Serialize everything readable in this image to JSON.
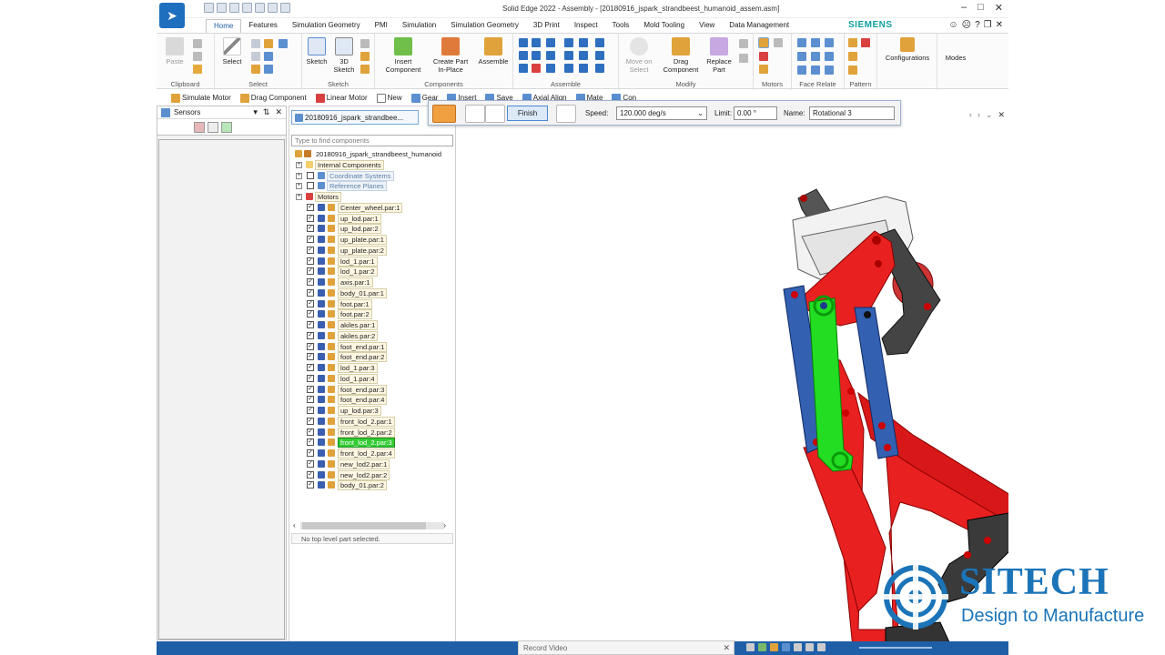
{
  "window": {
    "title": "Solid Edge 2022 - Assembly - [20180916_jspark_strandbeest_humanoid_assem.asm]"
  },
  "tabs": [
    "Home",
    "Features",
    "Simulation Geometry",
    "PMI",
    "Simulation",
    "Simulation Geometry",
    "3D Print",
    "Inspect",
    "Tools",
    "Mold Tooling",
    "View",
    "Data Management"
  ],
  "brand": "SIEMENS",
  "ribbon": {
    "paste": "Paste",
    "clipboard": "Clipboard",
    "select": "Select",
    "select_group": "Select",
    "sketch": "Sketch",
    "sketch3d_line1": "3D",
    "sketch3d_line2": "Sketch",
    "sketch_group": "Sketch",
    "insert_comp_line1": "Insert",
    "insert_comp_line2": "Component",
    "create_part_line1": "Create Part",
    "create_part_line2": "In-Place",
    "components_group": "Components",
    "assemble": "Assemble",
    "assemble_group": "Assemble",
    "move_on_select_line1": "Move on",
    "move_on_select_line2": "Select",
    "drag_comp_line1": "Drag",
    "drag_comp_line2": "Component",
    "replace_part_line1": "Replace",
    "replace_part_line2": "Part",
    "modify_group": "Modify",
    "motors_group": "Motors",
    "face_relate_group": "Face Relate",
    "pattern_group": "Pattern",
    "configurations": "Configurations",
    "modes": "Modes"
  },
  "cmdbar": [
    "Simulate Motor",
    "Drag Component",
    "Linear Motor",
    "New",
    "Gear",
    "Insert",
    "Save",
    "Axial Align",
    "Mate",
    "Con"
  ],
  "motorbar": {
    "finish": "Finish",
    "speed_label": "Speed:",
    "speed_value": "120.000 deg/s",
    "limit_label": "Limit:",
    "limit_value": "0.00 °",
    "name_label": "Name:",
    "name_value": "Rotational 3"
  },
  "sensors": {
    "title": "Sensors"
  },
  "pathfinder": {
    "doc_tab": "20180916_jspark_strandbee...",
    "find_placeholder": "Type to find components",
    "root": "20180916_jspark_strandbeest_humanoid",
    "folders": [
      "Internal Components",
      "Coordinate Systems",
      "Reference Planes",
      "Motors"
    ],
    "parts": [
      "Center_wheel.par:1",
      "up_lod.par:1",
      "up_lod.par:2",
      "up_plate.par:1",
      "up_plate.par:2",
      "lod_1.par:1",
      "lod_1.par:2",
      "axis.par:1",
      "body_01.par:1",
      "foot.par:1",
      "foot.par:2",
      "akiles.par:1",
      "akiles.par:2",
      "foot_end.par:1",
      "foot_end.par:2",
      "lod_1.par:3",
      "lod_1.par:4",
      "foot_end.par:3",
      "foot_end.par:4",
      "up_lod.par:3",
      "front_lod_2.par:1",
      "front_lod_2.par:2",
      "front_lod_2.par:3",
      "front_lod_2.par:4",
      "new_lod2.par:1",
      "new_lod2.par:2",
      "body_01.par:2"
    ],
    "selected_index": 22,
    "status": "No top level part selected."
  },
  "statusbar": {
    "record_video": "Record Video"
  },
  "watermark": {
    "title": "SITECH",
    "subtitle": "Design to Manufacture"
  },
  "colors": {
    "accent": "#1f5fa6",
    "brand": "#10a0a0",
    "selected": "#33cc33",
    "status_bar": "#1e5fa8",
    "watermark": "#1b74b8"
  }
}
